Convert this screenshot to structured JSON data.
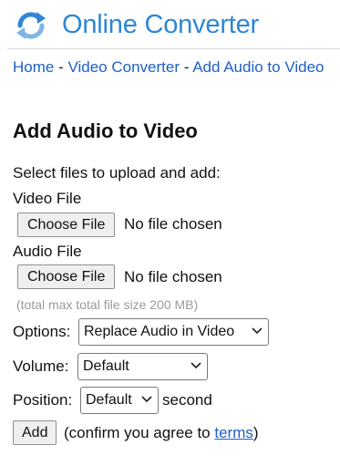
{
  "header": {
    "title": "Online Converter"
  },
  "breadcrumb": {
    "home": "Home",
    "sep1": " - ",
    "video_converter": "Video Converter",
    "sep2": " - ",
    "current": "Add Audio to Video"
  },
  "page": {
    "title": "Add Audio to Video",
    "instructions": "Select files to upload and add:"
  },
  "video_file": {
    "label": "Video File",
    "button": "Choose File",
    "status": "No file chosen"
  },
  "audio_file": {
    "label": "Audio File",
    "button": "Choose File",
    "status": "No file chosen"
  },
  "hint": "(total max total file size 200 MB)",
  "options": {
    "label": "Options:",
    "selected": "Replace Audio in Video"
  },
  "volume": {
    "label": "Volume:",
    "selected": "Default"
  },
  "position": {
    "label": "Position:",
    "selected": "Default",
    "suffix": "second"
  },
  "submit": {
    "button": "Add",
    "confirm_prefix": "(confirm you agree to ",
    "terms_link": "terms",
    "confirm_suffix": ")"
  },
  "colors": {
    "brand": "#2e86d4",
    "link": "#1e5fc8",
    "hint": "#9a9a9a"
  },
  "icons": {
    "logo": "refresh-arrows-icon",
    "dropdown": "chevron-down-icon"
  }
}
